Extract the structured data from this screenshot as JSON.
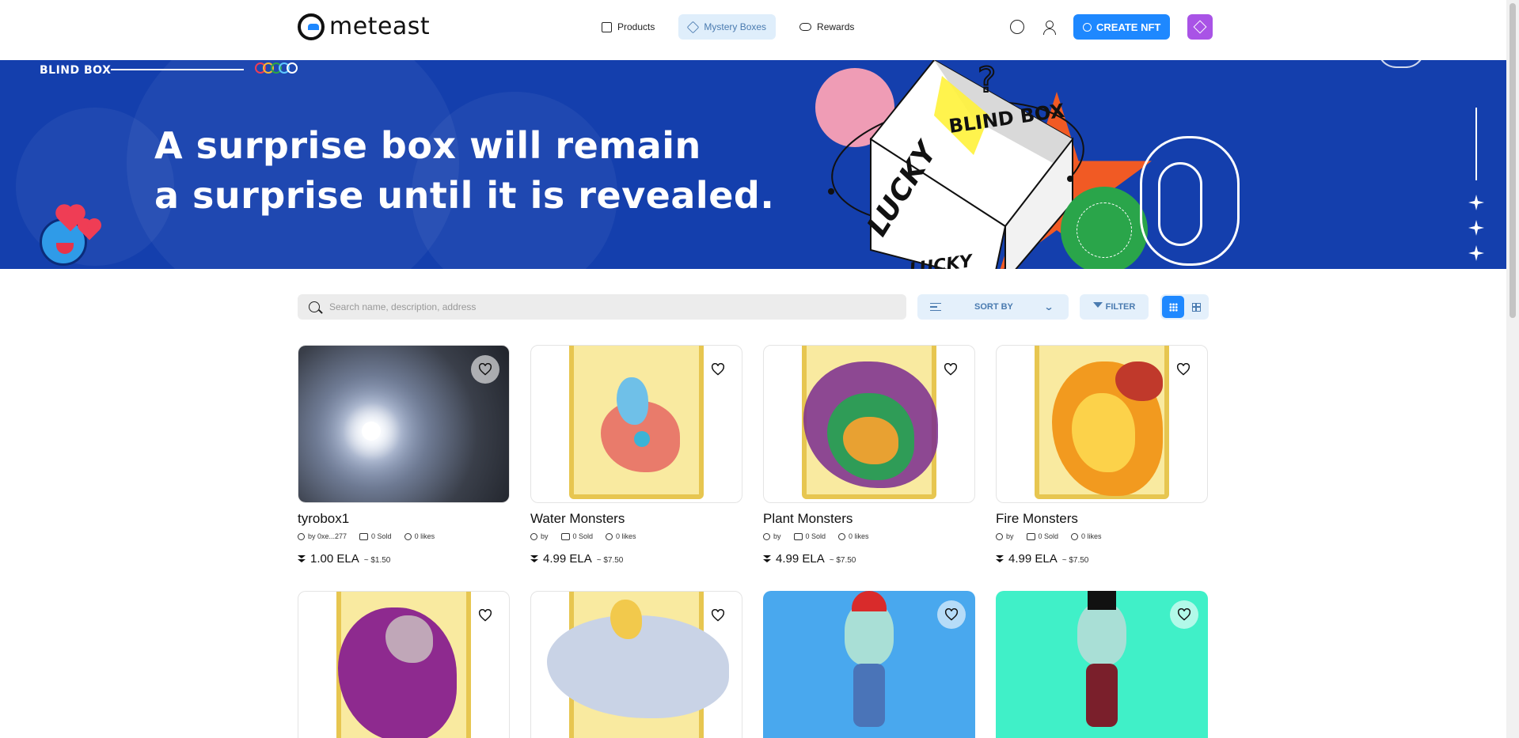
{
  "header": {
    "logo_text": "meteast",
    "nav": [
      {
        "label": "Products",
        "icon": "image-icon",
        "active": false
      },
      {
        "label": "Mystery Boxes",
        "icon": "box-icon",
        "active": true
      },
      {
        "label": "Rewards",
        "icon": "rewards-icon",
        "active": false
      }
    ],
    "create_label": "CREATE NFT"
  },
  "banner": {
    "brand": "BLIND BOX",
    "headline_line1": "A surprise box will remain",
    "headline_line2": "a surprise until it is revealed.",
    "cube_top_text": "BLIND BOX",
    "cube_side_text": "LUCKY",
    "cube_bottom_text": "LUCKY",
    "colors": {
      "background": "#143fad",
      "burst": "#f15a24",
      "pink": "#ef9cb5",
      "seal": "#2aa54a"
    }
  },
  "toolbar": {
    "search_placeholder": "Search name, description, address",
    "sort_label": "SORT BY",
    "filter_label": "FILTER"
  },
  "cards": [
    {
      "title": "tyrobox1",
      "by": "by 0xe...277",
      "sold": "0 Sold",
      "likes": "0 likes",
      "price": "1.00 ELA",
      "usd": "~ $1.50"
    },
    {
      "title": "Water Monsters",
      "by": "by",
      "sold": "0 Sold",
      "likes": "0 likes",
      "price": "4.99 ELA",
      "usd": "~ $7.50"
    },
    {
      "title": "Plant Monsters",
      "by": "by",
      "sold": "0 Sold",
      "likes": "0 likes",
      "price": "4.99 ELA",
      "usd": "~ $7.50"
    },
    {
      "title": "Fire Monsters",
      "by": "by",
      "sold": "0 Sold",
      "likes": "0 likes",
      "price": "4.99 ELA",
      "usd": "~ $7.50"
    }
  ],
  "accent_color": "#1e88ff"
}
